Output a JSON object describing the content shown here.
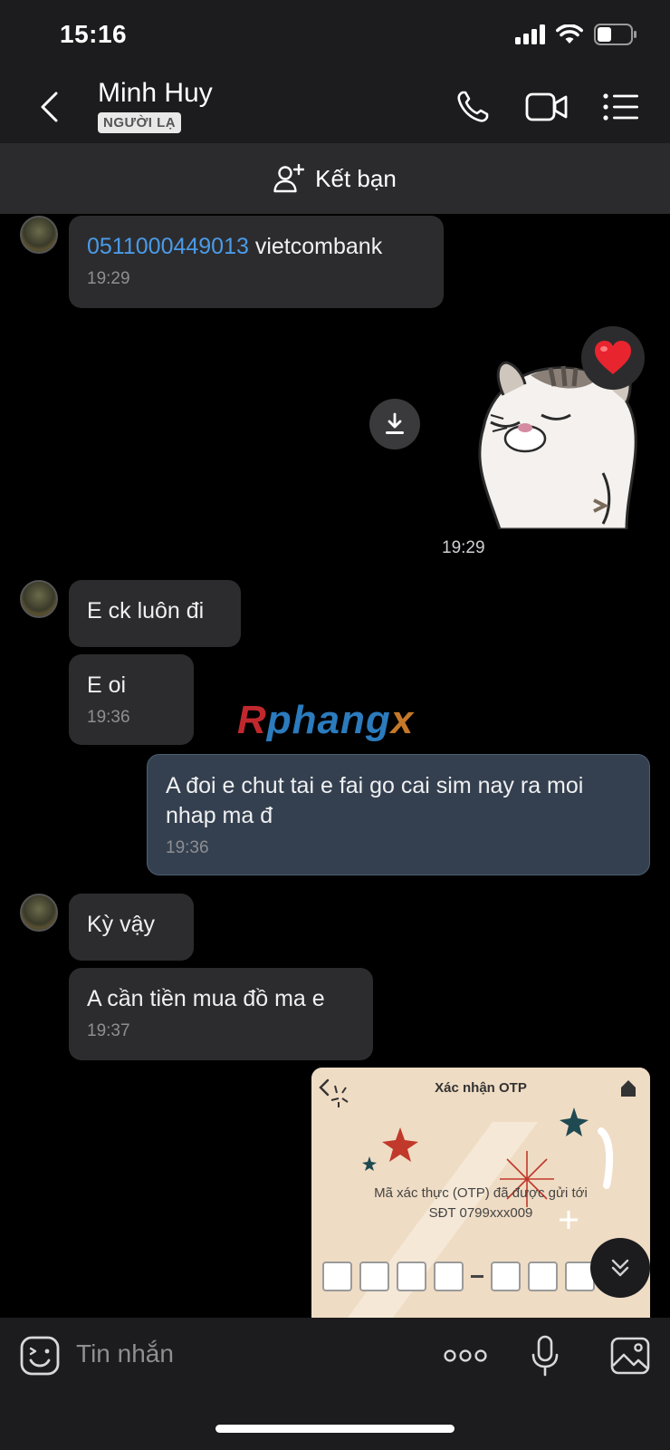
{
  "status_bar": {
    "time": "15:16"
  },
  "header": {
    "contact_name": "Minh Huy",
    "badge": "NGƯỜI LẠ"
  },
  "add_friend": {
    "label": "Kết bạn"
  },
  "messages": {
    "m1": {
      "account": "0511000449013",
      "bank": " vietcombank",
      "time": "19:29"
    },
    "sticker": {
      "time": "19:29",
      "reaction": "heart"
    },
    "m2": {
      "text": "E ck luôn đi"
    },
    "m3": {
      "text": "E oi",
      "time": "19:36"
    },
    "m4": {
      "text": "A đoi e chut tai e fai go cai sim nay ra moi nhap ma đ",
      "time": "19:36"
    },
    "m5": {
      "text": "Kỳ vậy"
    },
    "m6": {
      "text": "A cần tiền mua đồ ma e",
      "time": "19:37"
    }
  },
  "watermark": {
    "r": "R",
    "mid": "phang",
    "x": "x"
  },
  "otp_image": {
    "title": "Xác nhận OTP",
    "line1": "Mã xác thực (OTP) đã được gửi tới",
    "line2": "SĐT 0799xxx009"
  },
  "input": {
    "placeholder": "Tin nhắn"
  },
  "colors": {
    "link": "#4a9be8",
    "bubble": "#2c2c2e",
    "my_bubble": "#34404f",
    "header": "#1c1c1e"
  }
}
